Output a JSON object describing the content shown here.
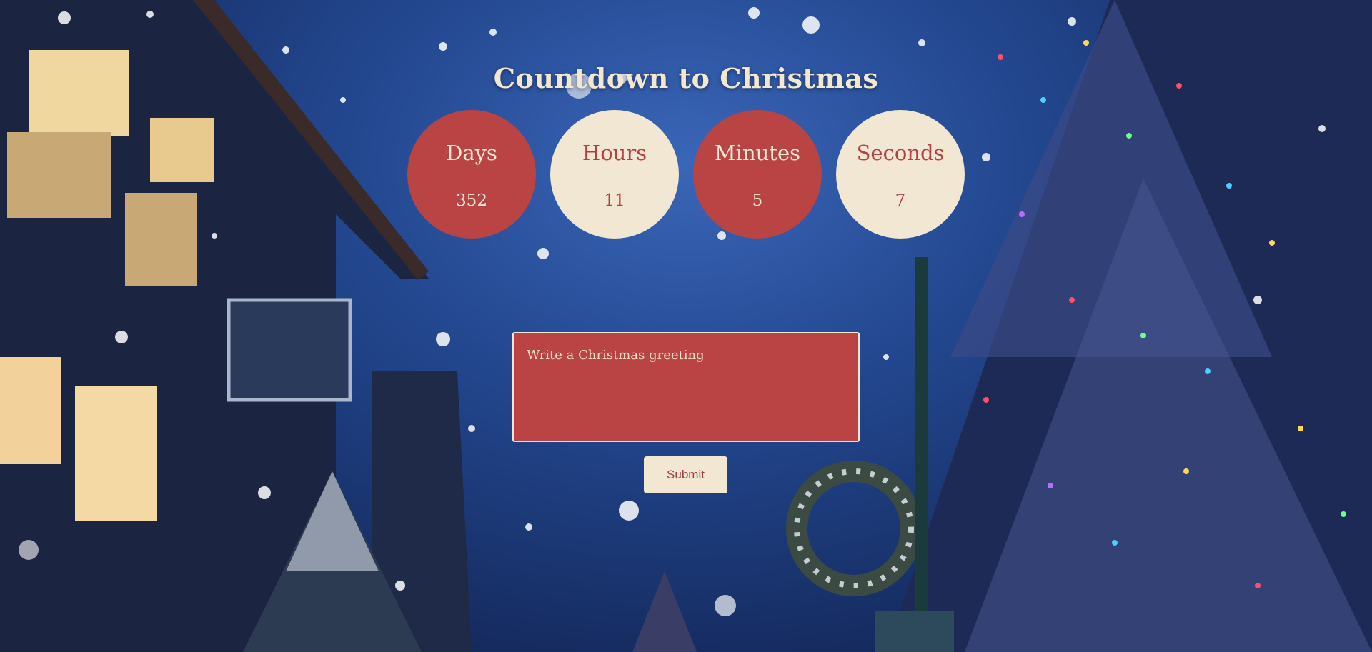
{
  "page": {
    "title": "Countdown to Christmas"
  },
  "countdown": [
    {
      "label": "Days",
      "value": "352",
      "style": "red"
    },
    {
      "label": "Hours",
      "value": "11",
      "style": "cream"
    },
    {
      "label": "Minutes",
      "value": "5",
      "style": "red"
    },
    {
      "label": "Seconds",
      "value": "7",
      "style": "cream"
    }
  ],
  "greeting": {
    "placeholder": "Write a Christmas greeting",
    "value": ""
  },
  "submit": {
    "label": "Submit"
  },
  "colors": {
    "red": "#b94443",
    "cream": "#f2e7d2",
    "background": "#23478f"
  }
}
